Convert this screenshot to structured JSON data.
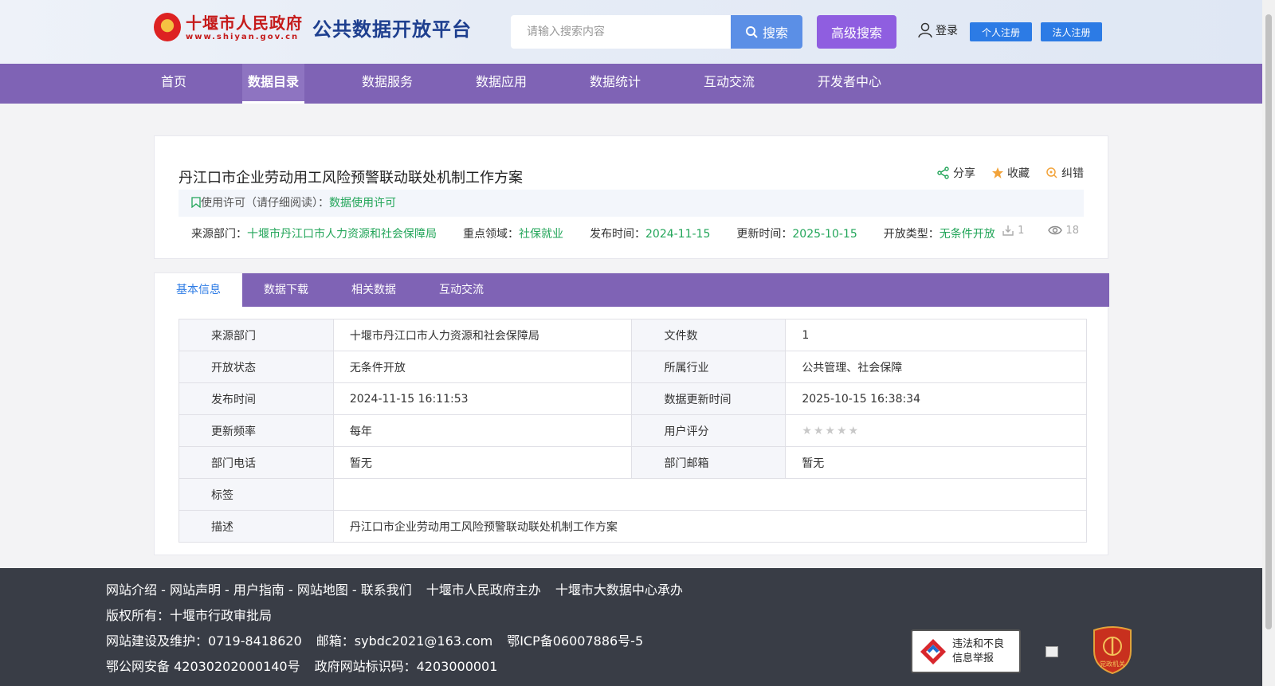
{
  "header": {
    "logo_cn": "十堰市人民政府",
    "logo_url": "www.shiyan.gov.cn",
    "platform_name": "公共数据开放平台",
    "search_placeholder": "请输入搜索内容",
    "search_label": "搜索",
    "advanced_search_label": "高级搜索",
    "login_label": "登录",
    "register_personal": "个人注册",
    "register_legal": "法人注册"
  },
  "nav": {
    "items": [
      {
        "label": "首页"
      },
      {
        "label": "数据目录"
      },
      {
        "label": "数据服务"
      },
      {
        "label": "数据应用"
      },
      {
        "label": "数据统计"
      },
      {
        "label": "互动交流"
      },
      {
        "label": "开发者中心"
      }
    ],
    "active": "数据目录"
  },
  "dataset": {
    "title": "丹江口市企业劳动用工风险预警联动联处机制工作方案",
    "actions": {
      "share": "分享",
      "favorite": "收藏",
      "correct": "纠错"
    },
    "license_prefix": "使用许可（请仔细阅读）：",
    "license_link": "数据使用许可",
    "meta": {
      "source_label": "来源部门：",
      "source_value": "十堰市丹江口市人力资源和社会保障局",
      "domain_label": "重点领域：",
      "domain_value": "社保就业",
      "publish_label": "发布时间：",
      "publish_value": "2024-11-15",
      "update_label": "更新时间：",
      "update_value": "2025-10-15",
      "open_label": "开放类型：",
      "open_value": "无条件开放"
    },
    "download_count": "1",
    "view_count": "18"
  },
  "tabs": [
    {
      "label": "基本信息"
    },
    {
      "label": "数据下载"
    },
    {
      "label": "相关数据"
    },
    {
      "label": "互动交流"
    }
  ],
  "info_table": {
    "r1": {
      "l1": "来源部门",
      "v1": "十堰市丹江口市人力资源和社会保障局",
      "l2": "文件数",
      "v2": "1"
    },
    "r2": {
      "l1": "开放状态",
      "v1": "无条件开放",
      "l2": "所属行业",
      "v2": "公共管理、社会保障"
    },
    "r3": {
      "l1": "发布时间",
      "v1": "2024-11-15 16:11:53",
      "l2": "数据更新时间",
      "v2": "2025-10-15 16:38:34"
    },
    "r4": {
      "l1": "更新频率",
      "v1": "每年",
      "l2": "用户评分",
      "rating": 0,
      "rating_max": 5
    },
    "r5": {
      "l1": "部门电话",
      "v1": "暂无",
      "l2": "部门邮箱",
      "v2": "暂无"
    },
    "r6": {
      "l1": "标签",
      "v1": ""
    },
    "r7": {
      "l1": "描述",
      "v1": "丹江口市企业劳动用工风险预警联动联处机制工作方案"
    }
  },
  "footer": {
    "links": "网站介绍 - 网站声明 - 用户指南 - 网站地图 - 联系我们",
    "host": "十堰市人民政府主办",
    "organizer": "十堰市大数据中心承办",
    "copyright": "版权所有：十堰市行政审批局",
    "maintain": "网站建设及维护：0719-8418620",
    "email": "邮箱：sybdc2021@163.com",
    "icp": "鄂ICP备06007886号-5",
    "police": "鄂公网安备 42030202000140号",
    "gov_id": "政府网站标识码：4203000001",
    "report_line1": "违法和不良",
    "report_line2": "信息举报",
    "party_badge_text": "党政机关"
  },
  "colors": {
    "nav": "#7f63b5",
    "accent_green": "#22a559",
    "search_blue": "#5b8fe6",
    "adv_purple": "#8f5ee0",
    "register_blue": "#2c7be5"
  }
}
